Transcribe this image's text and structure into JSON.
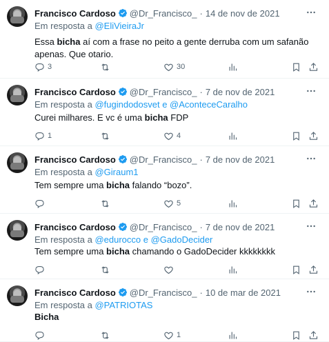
{
  "tweets": [
    {
      "name": "Francisco Cardoso",
      "handle": "@Dr_Francisco_",
      "date": "14 de nov de 2021",
      "reply_prefix": "Em resposta a",
      "reply_to": "@EliVieiraJr",
      "text_before": "Essa ",
      "text_bold": "bicha",
      "text_after": " aí com a frase no peito a gente derruba com um safanão apenas. Que otario.",
      "replies": "3",
      "retweets": "",
      "likes": "30"
    },
    {
      "name": "Francisco Cardoso",
      "handle": "@Dr_Francisco_",
      "date": "7 de nov de 2021",
      "reply_prefix": "Em resposta a",
      "reply_to": "@fugindodosvet e @AconteceCaralho",
      "text_before": "Curei milhares. E vc é uma ",
      "text_bold": "bicha",
      "text_after": " FDP",
      "replies": "1",
      "retweets": "",
      "likes": "4"
    },
    {
      "name": "Francisco Cardoso",
      "handle": "@Dr_Francisco_",
      "date": "7 de nov de 2021",
      "reply_prefix": "Em resposta a",
      "reply_to": "@Giraum1",
      "text_before": "Tem sempre uma ",
      "text_bold": "bicha",
      "text_after": " falando “bozo”.",
      "replies": "",
      "retweets": "",
      "likes": "5"
    },
    {
      "name": "Francisco Cardoso",
      "handle": "@Dr_Francisco_",
      "date": "7 de nov de 2021",
      "reply_prefix": "Em resposta a",
      "reply_to": "@edurocco e @GadoDecider",
      "text_before": "Tem sempre uma ",
      "text_bold": "bicha",
      "text_after": " chamando o GadoDecider kkkkkkkk",
      "replies": "",
      "retweets": "",
      "likes": ""
    },
    {
      "name": "Francisco Cardoso",
      "handle": "@Dr_Francisco_",
      "date": "10 de mar de 2021",
      "reply_prefix": "Em resposta a",
      "reply_to": "@PATRIOTAS",
      "text_before": "",
      "text_bold": "Bicha",
      "text_after": "",
      "replies": "",
      "retweets": "",
      "likes": "1"
    }
  ],
  "icons": {
    "verified_color": "#1d9bf0",
    "link_color": "#1d9bf0",
    "muted_color": "#536471"
  }
}
